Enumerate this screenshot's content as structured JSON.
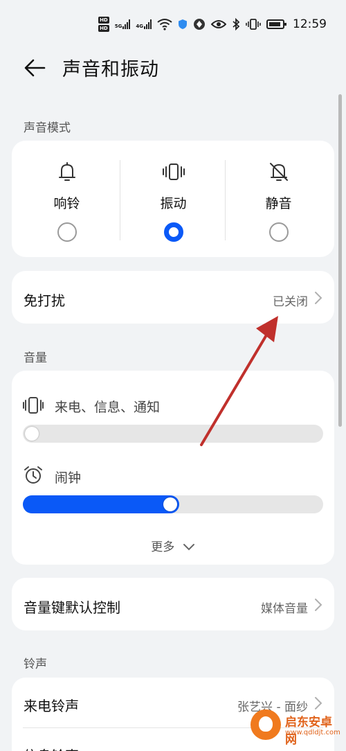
{
  "status_bar": {
    "hd1": "HD",
    "hd2": "HD",
    "net1": "5G",
    "net2": "4G",
    "time": "12:59"
  },
  "header": {
    "title": "声音和振动"
  },
  "sound_mode": {
    "section_label": "声音模式",
    "options": [
      {
        "label": "响铃",
        "icon": "bell-icon",
        "selected": false
      },
      {
        "label": "振动",
        "icon": "vibrate-icon",
        "selected": true
      },
      {
        "label": "静音",
        "icon": "bell-off-icon",
        "selected": false
      }
    ]
  },
  "dnd": {
    "title": "免打扰",
    "value": "已关闭"
  },
  "volume": {
    "section_label": "音量",
    "sliders": [
      {
        "label": "来电、信息、通知",
        "icon": "vibrate-icon",
        "level": 0.0
      },
      {
        "label": "闹钟",
        "icon": "alarm-clock-icon",
        "level": 0.52
      }
    ],
    "more_label": "更多"
  },
  "volume_key": {
    "title": "音量键默认控制",
    "value": "媒体音量"
  },
  "ringtone": {
    "section_label": "铃声",
    "items": [
      {
        "title": "来电铃声",
        "value": "张艺兴 - 面纱"
      },
      {
        "title": "信息铃声",
        "value": ""
      }
    ]
  },
  "watermark": {
    "title": "启东安卓网",
    "url": "www.qdldjt.com"
  },
  "colors": {
    "accent": "#0a59f7",
    "annotation_arrow": "#c0302c"
  }
}
